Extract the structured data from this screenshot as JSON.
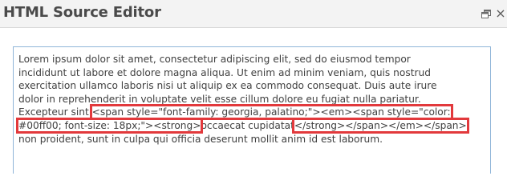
{
  "dialog": {
    "title": "HTML Source Editor",
    "resize_icon": "restore-window-icon",
    "close_icon": "close-icon",
    "close_glyph": "×"
  },
  "editor": {
    "lines": {
      "l1": "Lorem ipsum dolor sit amet, consectetur adipiscing elit, sed do eiusmod tempor",
      "l2": "incididunt ut labore et dolore magna aliqua. Ut enim ad minim veniam, quis nostrud",
      "l3": "exercitation ullamco laboris nisi ut aliquip ex ea commodo consequat. Duis aute irure",
      "l4": "dolor in reprehenderit in voluptate velit esse cillum dolore eu fugiat nulla pariatur.",
      "l5_pre": "Excepteur sint ",
      "l5_tag1": "<span style=\"font-family: georgia, palatino;\"><em><span style=\"color:",
      "l6_tag2": "#00ff00; font-size: 18px;\"><strong>",
      "l6_mid": "occaecat cupidatat",
      "l6_tag3": "</strong></span></em></span>",
      "l7": "non proident, sunt in culpa qui officia deserunt mollit anim id est laborum."
    },
    "highlight_color": "#e2393c",
    "border_color": "#8fb5d8"
  }
}
